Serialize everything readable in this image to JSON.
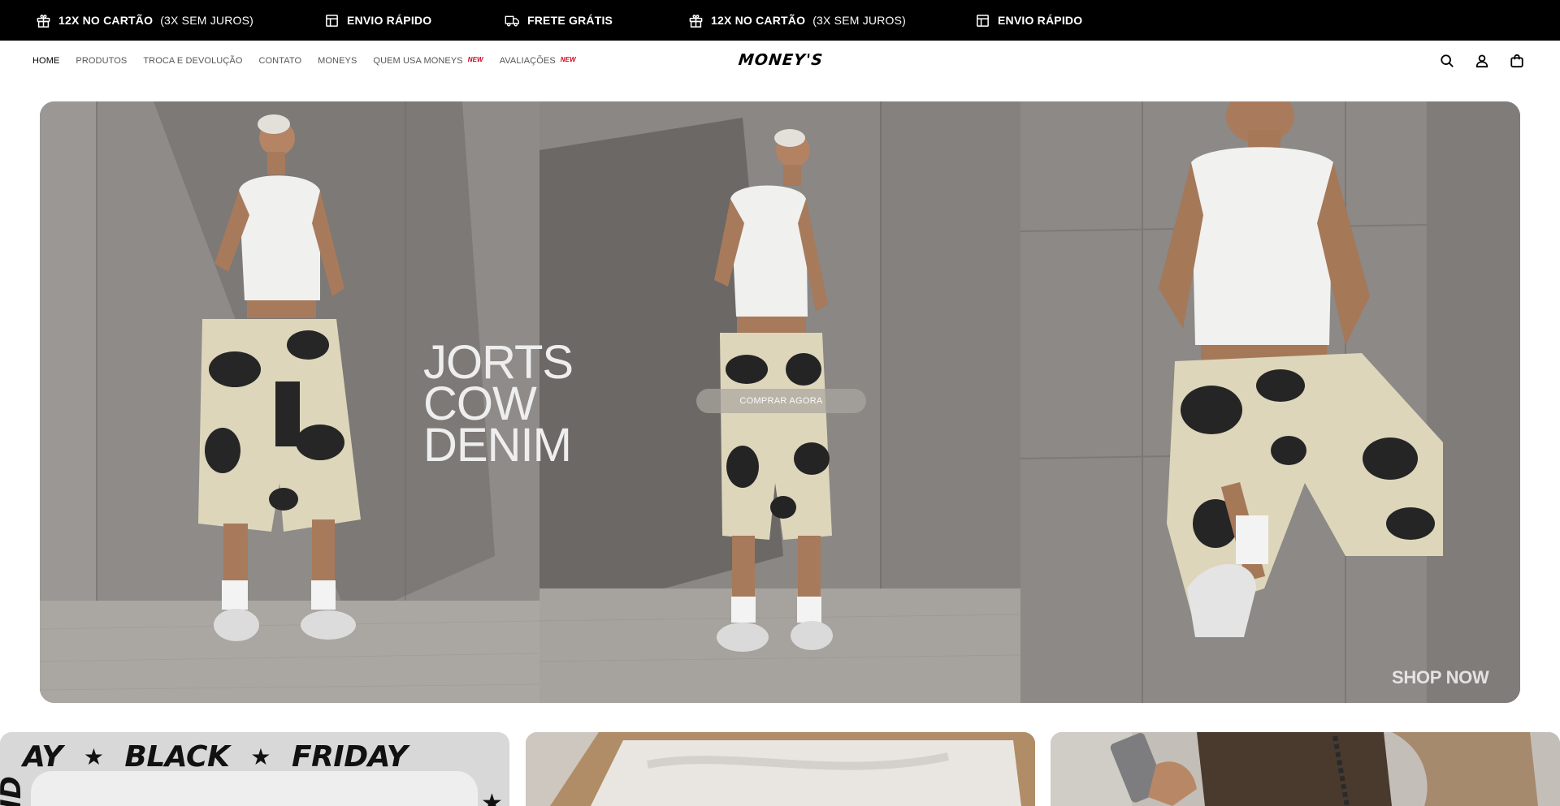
{
  "announcement_bar": {
    "items": [
      {
        "icon": "gift-icon",
        "strong": "12X NO CARTÃO",
        "light": "(3X SEM JUROS)"
      },
      {
        "icon": "box-icon",
        "strong": "ENVIO RÁPIDO",
        "light": ""
      },
      {
        "icon": "truck-icon",
        "strong": "FRETE GRÁTIS",
        "light": ""
      },
      {
        "icon": "gift-icon",
        "strong": "12X NO CARTÃO",
        "light": "(3X SEM JUROS)"
      },
      {
        "icon": "box-icon",
        "strong": "ENVIO RÁPIDO",
        "light": ""
      }
    ]
  },
  "header": {
    "nav": [
      {
        "label": "HOME",
        "badge": "",
        "active": true
      },
      {
        "label": "PRODUTOS",
        "badge": ""
      },
      {
        "label": "TROCA E DEVOLUÇÃO",
        "badge": ""
      },
      {
        "label": "CONTATO",
        "badge": ""
      },
      {
        "label": "MONEYS",
        "badge": ""
      },
      {
        "label": "QUEM USA MONEYS",
        "badge": "NEW"
      },
      {
        "label": "AVALIAÇÕES",
        "badge": "NEW"
      }
    ],
    "logo": "MONEY'S",
    "icons": [
      "search-icon",
      "account-icon",
      "cart-bag-icon"
    ]
  },
  "hero": {
    "title": "JORTS\nCOW\nDENIM",
    "cta": "COMPRAR AGORA",
    "shop_now": "SHOP NOW"
  },
  "cards": {
    "card1": {
      "marquee": [
        "AY",
        "BLACK",
        "FRIDAY"
      ],
      "side_text": "ID"
    }
  },
  "colors": {
    "announcement_bg": "#000000",
    "badge_new": "#d4001b",
    "wall_gray": "#8d8a87"
  }
}
